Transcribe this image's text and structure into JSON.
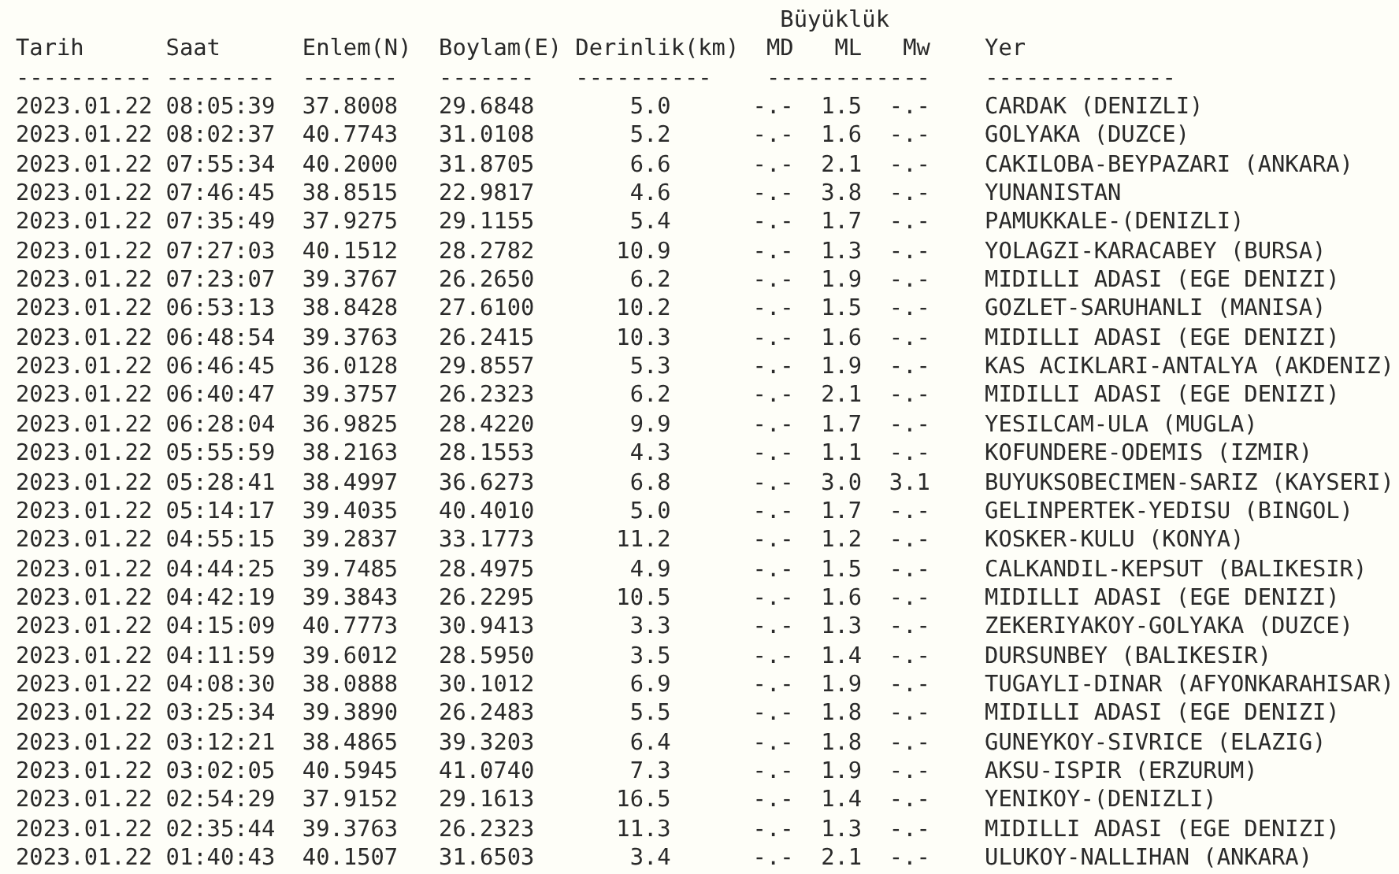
{
  "magnitude_group_label": "Büyüklük",
  "columns": [
    "Tarih",
    "Saat",
    "Enlem(N)",
    "Boylam(E)",
    "Derinlik(km)",
    "MD",
    "ML",
    "Mw",
    "Yer"
  ],
  "column_underlines": [
    "----------",
    "--------",
    "-------",
    "-------",
    "----------",
    "------------",
    "--------------"
  ],
  "rows": [
    {
      "date": "2023.01.22",
      "time": "08:05:39",
      "lat": "37.8008",
      "lon": "29.6848",
      "depth": "5.0",
      "md": "-.-",
      "ml": "1.5",
      "mw": "-.-",
      "location": "CARDAK (DENIZLI)"
    },
    {
      "date": "2023.01.22",
      "time": "08:02:37",
      "lat": "40.7743",
      "lon": "31.0108",
      "depth": "5.2",
      "md": "-.-",
      "ml": "1.6",
      "mw": "-.-",
      "location": "GOLYAKA (DUZCE)"
    },
    {
      "date": "2023.01.22",
      "time": "07:55:34",
      "lat": "40.2000",
      "lon": "31.8705",
      "depth": "6.6",
      "md": "-.-",
      "ml": "2.1",
      "mw": "-.-",
      "location": "CAKILOBA-BEYPAZARI (ANKARA)"
    },
    {
      "date": "2023.01.22",
      "time": "07:46:45",
      "lat": "38.8515",
      "lon": "22.9817",
      "depth": "4.6",
      "md": "-.-",
      "ml": "3.8",
      "mw": "-.-",
      "location": "YUNANISTAN"
    },
    {
      "date": "2023.01.22",
      "time": "07:35:49",
      "lat": "37.9275",
      "lon": "29.1155",
      "depth": "5.4",
      "md": "-.-",
      "ml": "1.7",
      "mw": "-.-",
      "location": "PAMUKKALE-(DENIZLI)"
    },
    {
      "date": "2023.01.22",
      "time": "07:27:03",
      "lat": "40.1512",
      "lon": "28.2782",
      "depth": "10.9",
      "md": "-.-",
      "ml": "1.3",
      "mw": "-.-",
      "location": "YOLAGZI-KARACABEY (BURSA)"
    },
    {
      "date": "2023.01.22",
      "time": "07:23:07",
      "lat": "39.3767",
      "lon": "26.2650",
      "depth": "6.2",
      "md": "-.-",
      "ml": "1.9",
      "mw": "-.-",
      "location": "MIDILLI ADASI (EGE DENIZI)"
    },
    {
      "date": "2023.01.22",
      "time": "06:53:13",
      "lat": "38.8428",
      "lon": "27.6100",
      "depth": "10.2",
      "md": "-.-",
      "ml": "1.5",
      "mw": "-.-",
      "location": "GOZLET-SARUHANLI (MANISA)"
    },
    {
      "date": "2023.01.22",
      "time": "06:48:54",
      "lat": "39.3763",
      "lon": "26.2415",
      "depth": "10.3",
      "md": "-.-",
      "ml": "1.6",
      "mw": "-.-",
      "location": "MIDILLI ADASI (EGE DENIZI)"
    },
    {
      "date": "2023.01.22",
      "time": "06:46:45",
      "lat": "36.0128",
      "lon": "29.8557",
      "depth": "5.3",
      "md": "-.-",
      "ml": "1.9",
      "mw": "-.-",
      "location": "KAS ACIKLARI-ANTALYA (AKDENIZ)"
    },
    {
      "date": "2023.01.22",
      "time": "06:40:47",
      "lat": "39.3757",
      "lon": "26.2323",
      "depth": "6.2",
      "md": "-.-",
      "ml": "2.1",
      "mw": "-.-",
      "location": "MIDILLI ADASI (EGE DENIZI)"
    },
    {
      "date": "2023.01.22",
      "time": "06:28:04",
      "lat": "36.9825",
      "lon": "28.4220",
      "depth": "9.9",
      "md": "-.-",
      "ml": "1.7",
      "mw": "-.-",
      "location": "YESILCAM-ULA (MUGLA)"
    },
    {
      "date": "2023.01.22",
      "time": "05:55:59",
      "lat": "38.2163",
      "lon": "28.1553",
      "depth": "4.3",
      "md": "-.-",
      "ml": "1.1",
      "mw": "-.-",
      "location": "KOFUNDERE-ODEMIS (IZMIR)"
    },
    {
      "date": "2023.01.22",
      "time": "05:28:41",
      "lat": "38.4997",
      "lon": "36.6273",
      "depth": "6.8",
      "md": "-.-",
      "ml": "3.0",
      "mw": "3.1",
      "location": "BUYUKSOBECIMEN-SARIZ (KAYSERI)"
    },
    {
      "date": "2023.01.22",
      "time": "05:14:17",
      "lat": "39.4035",
      "lon": "40.4010",
      "depth": "5.0",
      "md": "-.-",
      "ml": "1.7",
      "mw": "-.-",
      "location": "GELINPERTEK-YEDISU (BINGOL)"
    },
    {
      "date": "2023.01.22",
      "time": "04:55:15",
      "lat": "39.2837",
      "lon": "33.1773",
      "depth": "11.2",
      "md": "-.-",
      "ml": "1.2",
      "mw": "-.-",
      "location": "KOSKER-KULU (KONYA)"
    },
    {
      "date": "2023.01.22",
      "time": "04:44:25",
      "lat": "39.7485",
      "lon": "28.4975",
      "depth": "4.9",
      "md": "-.-",
      "ml": "1.5",
      "mw": "-.-",
      "location": "CALKANDIL-KEPSUT (BALIKESIR)"
    },
    {
      "date": "2023.01.22",
      "time": "04:42:19",
      "lat": "39.3843",
      "lon": "26.2295",
      "depth": "10.5",
      "md": "-.-",
      "ml": "1.6",
      "mw": "-.-",
      "location": "MIDILLI ADASI (EGE DENIZI)"
    },
    {
      "date": "2023.01.22",
      "time": "04:15:09",
      "lat": "40.7773",
      "lon": "30.9413",
      "depth": "3.3",
      "md": "-.-",
      "ml": "1.3",
      "mw": "-.-",
      "location": "ZEKERIYAKOY-GOLYAKA (DUZCE)"
    },
    {
      "date": "2023.01.22",
      "time": "04:11:59",
      "lat": "39.6012",
      "lon": "28.5950",
      "depth": "3.5",
      "md": "-.-",
      "ml": "1.4",
      "mw": "-.-",
      "location": "DURSUNBEY (BALIKESIR)"
    },
    {
      "date": "2023.01.22",
      "time": "04:08:30",
      "lat": "38.0888",
      "lon": "30.1012",
      "depth": "6.9",
      "md": "-.-",
      "ml": "1.9",
      "mw": "-.-",
      "location": "TUGAYLI-DINAR (AFYONKARAHISAR)"
    },
    {
      "date": "2023.01.22",
      "time": "03:25:34",
      "lat": "39.3890",
      "lon": "26.2483",
      "depth": "5.5",
      "md": "-.-",
      "ml": "1.8",
      "mw": "-.-",
      "location": "MIDILLI ADASI (EGE DENIZI)"
    },
    {
      "date": "2023.01.22",
      "time": "03:12:21",
      "lat": "38.4865",
      "lon": "39.3203",
      "depth": "6.4",
      "md": "-.-",
      "ml": "1.8",
      "mw": "-.-",
      "location": "GUNEYKOY-SIVRICE (ELAZIG)"
    },
    {
      "date": "2023.01.22",
      "time": "03:02:05",
      "lat": "40.5945",
      "lon": "41.0740",
      "depth": "7.3",
      "md": "-.-",
      "ml": "1.9",
      "mw": "-.-",
      "location": "AKSU-ISPIR (ERZURUM)"
    },
    {
      "date": "2023.01.22",
      "time": "02:54:29",
      "lat": "37.9152",
      "lon": "29.1613",
      "depth": "16.5",
      "md": "-.-",
      "ml": "1.4",
      "mw": "-.-",
      "location": "YENIKOY-(DENIZLI)"
    },
    {
      "date": "2023.01.22",
      "time": "02:35:44",
      "lat": "39.3763",
      "lon": "26.2323",
      "depth": "11.3",
      "md": "-.-",
      "ml": "1.3",
      "mw": "-.-",
      "location": "MIDILLI ADASI (EGE DENIZI)"
    },
    {
      "date": "2023.01.22",
      "time": "01:40:43",
      "lat": "40.1507",
      "lon": "31.6503",
      "depth": "3.4",
      "md": "-.-",
      "ml": "2.1",
      "mw": "-.-",
      "location": "ULUKOY-NALLIHAN (ANKARA)"
    }
  ]
}
